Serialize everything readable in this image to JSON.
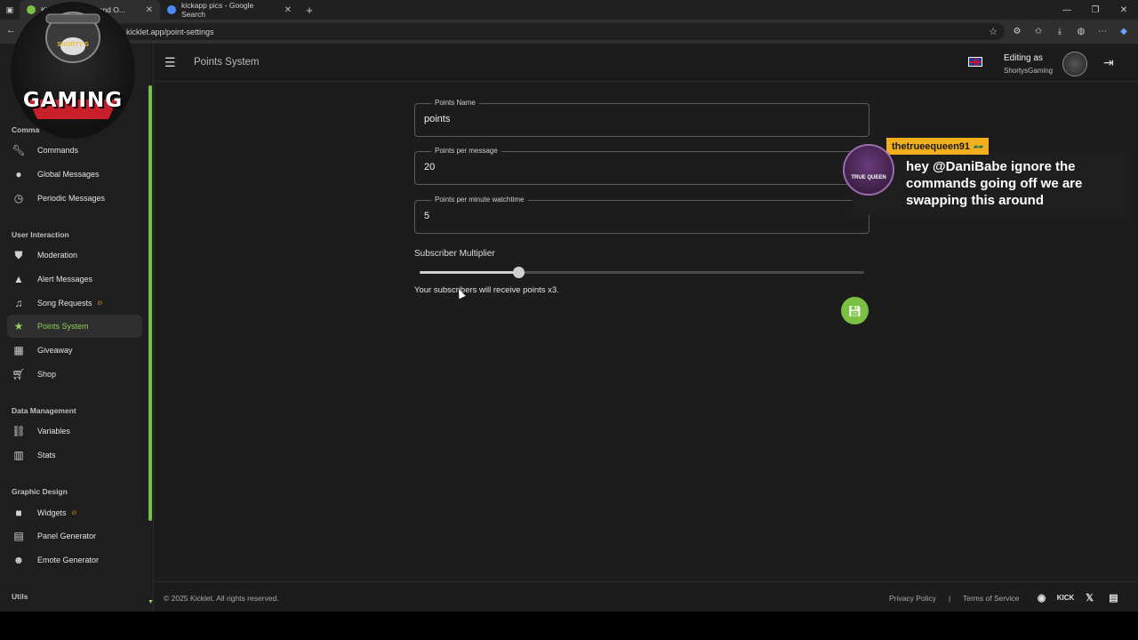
{
  "browser": {
    "tabs": [
      {
        "label": "Kicklet - Chatbot and O..."
      },
      {
        "label": "kickapp pics - Google Search"
      }
    ],
    "new_tab": "+",
    "url": "kicklet.app/point-settings"
  },
  "logo": {
    "title": "GAMING",
    "subtitle": "SHORTY'S"
  },
  "sidebar": {
    "sections": {
      "commands": "Comma",
      "user_interaction": "User Interaction",
      "data_management": "Data Management",
      "graphic_design": "Graphic Design",
      "utils": "Utils"
    },
    "items": {
      "commands": "Commands",
      "global_messages": "Global Messages",
      "periodic_messages": "Periodic Messages",
      "moderation": "Moderation",
      "alert_messages": "Alert Messages",
      "song_requests": "Song Requests",
      "points_system": "Points System",
      "giveaway": "Giveaway",
      "shop": "Shop",
      "variables": "Variables",
      "stats": "Stats",
      "widgets": "Widgets",
      "panel_generator": "Panel Generator",
      "emote_generator": "Emote Generator"
    }
  },
  "header": {
    "title": "Points System",
    "editing_as": "Editing as",
    "user": "ShortysGaming"
  },
  "form": {
    "points_name": {
      "label": "Points Name",
      "value": "points"
    },
    "points_per_message": {
      "label": "Points per message",
      "value": "20"
    },
    "points_per_minute": {
      "label": "Points per minute watchtime",
      "value": "5"
    },
    "multiplier": {
      "label": "Subscriber Multiplier",
      "value": 3,
      "min": 1,
      "max": 10,
      "text": "Your subscribers will receive points x3."
    }
  },
  "footer": {
    "copyright": "© 2025 Kicklet. All rights reserved.",
    "privacy": "Privacy Policy",
    "separator": "|",
    "terms": "Terms of Service",
    "kick": "KICK"
  },
  "chat": {
    "username": "thetrueequeen91",
    "avatar_text": "TRUE QUEEN",
    "message": "hey @DaniBabe ignore the commands going off we are swapping this around"
  },
  "colors": {
    "accent": "#7ac143",
    "name_bg": "#f2b01e"
  }
}
